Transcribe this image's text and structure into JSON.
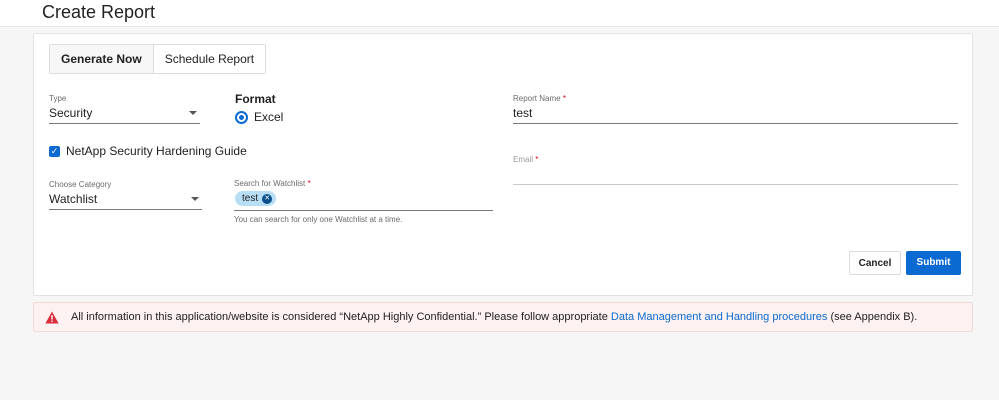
{
  "page": {
    "title": "Create Report"
  },
  "tabs": [
    {
      "label": "Generate Now",
      "active": true
    },
    {
      "label": "Schedule Report",
      "active": false
    }
  ],
  "type_field": {
    "label": "Type",
    "value": "Security"
  },
  "format": {
    "title": "Format",
    "option": "Excel",
    "selected": true
  },
  "report_name": {
    "label": "Report Name",
    "required_mark": "*",
    "value": "test"
  },
  "checkbox": {
    "label": "NetApp Security Hardening Guide",
    "checked": true,
    "check_glyph": "✓"
  },
  "email": {
    "label": "Email",
    "required_mark": "*",
    "value": ""
  },
  "category": {
    "label": "Choose Category",
    "value": "Watchlist"
  },
  "watchlist": {
    "label": "Search for Watchlist",
    "required_mark": "*",
    "chip": "test",
    "chip_remove_glyph": "✕",
    "helper": "You can search for only one Watchlist at a time."
  },
  "buttons": {
    "cancel": "Cancel",
    "submit": "Submit"
  },
  "banner": {
    "text_before": "All information in this application/website is considered “NetApp Highly Confidential.” Please follow appropriate ",
    "link": "Data Management and Handling procedures",
    "text_after": " (see Appendix B)."
  },
  "colors": {
    "accent": "#0b6ad1",
    "chip_bg": "#b8def6",
    "banner_bg": "#fdf1f1",
    "warning": "#d92d3a",
    "required": "#d0021b"
  }
}
